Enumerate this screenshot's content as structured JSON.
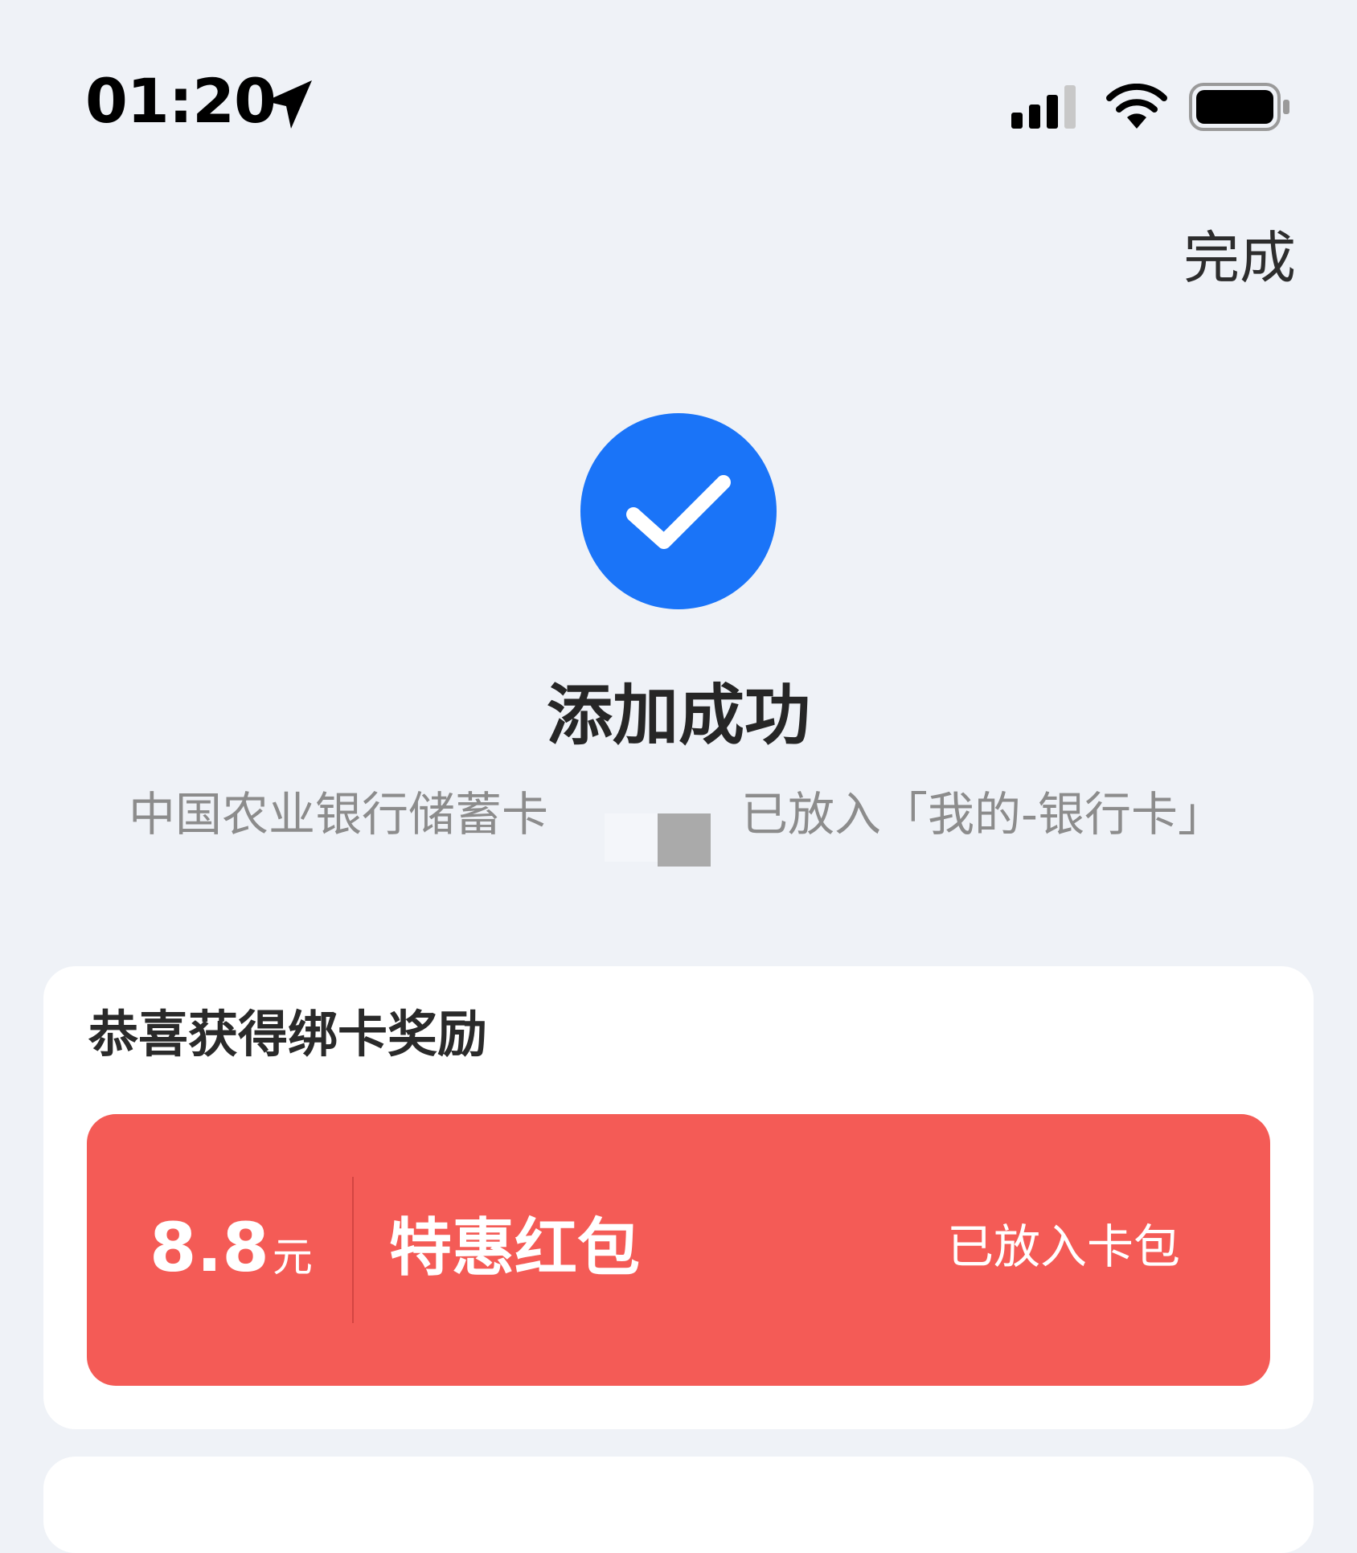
{
  "status_bar": {
    "time": "01:20"
  },
  "header": {
    "done_label": "完成"
  },
  "result": {
    "title": "添加成功",
    "desc_prefix": "中国农业银行储蓄卡",
    "desc_suffix": "已放入「我的-银行卡」"
  },
  "reward": {
    "title": "恭喜获得绑卡奖励",
    "coupon": {
      "amount": "8.8",
      "unit": "元",
      "name": "特惠红包",
      "status": "已放入卡包"
    }
  },
  "colors": {
    "accent": "#1a74f8",
    "coupon": "#f45b56",
    "background": "#eff2f7"
  }
}
